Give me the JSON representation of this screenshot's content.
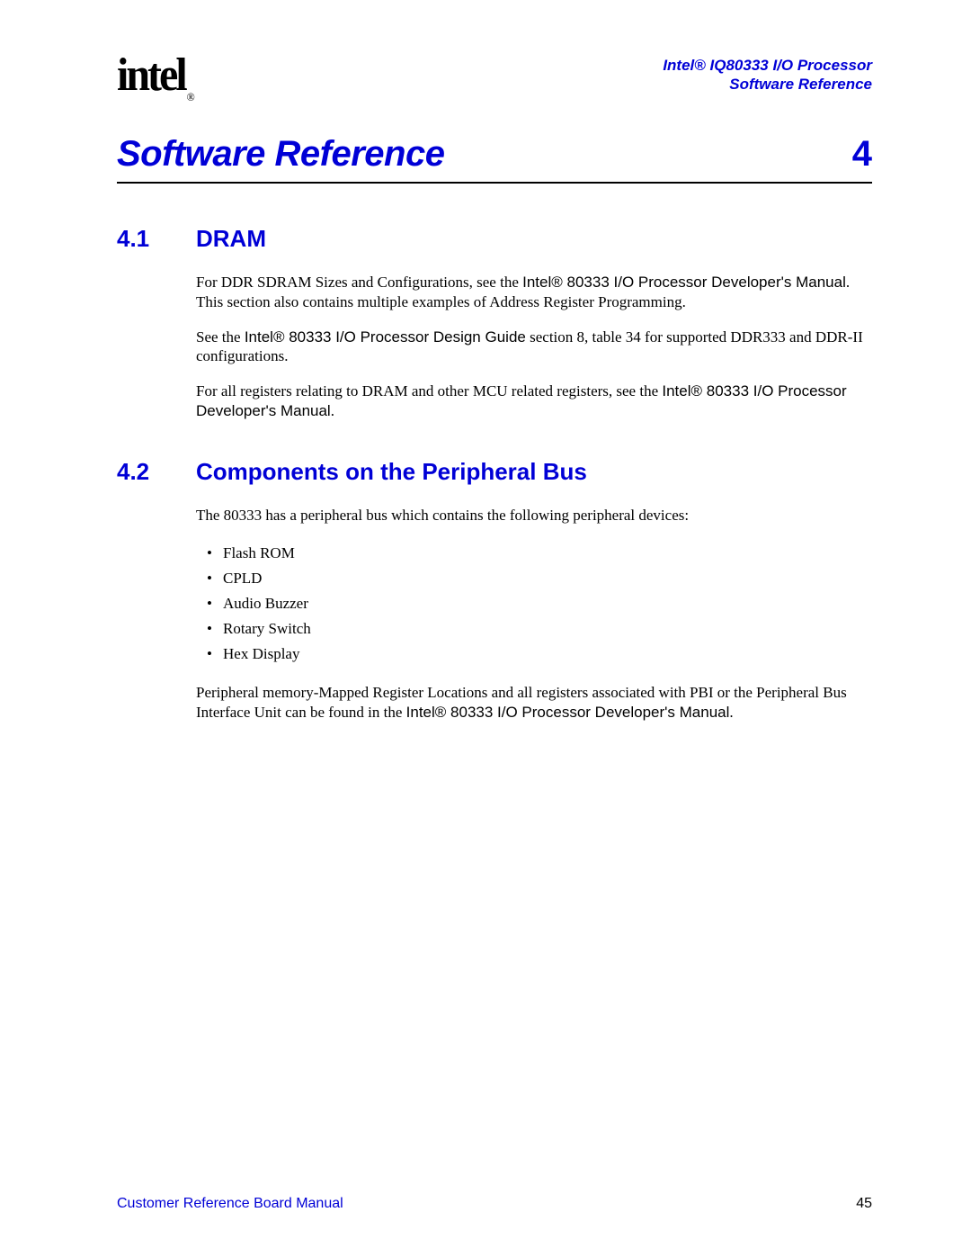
{
  "header": {
    "logo_text": "intel",
    "logo_reg": "®",
    "product": "Intel® IQ80333 I/O Processor",
    "subtitle": "Software Reference"
  },
  "chapter": {
    "title": "Software Reference",
    "number": "4"
  },
  "sections": {
    "s41": {
      "num": "4.1",
      "title": "DRAM",
      "p1a": "For DDR SDRAM Sizes and Configurations, see the ",
      "p1b": "Intel® 80333 I/O Processor Developer's Manual",
      "p1c": ". This section also contains multiple examples of Address Register Programming.",
      "p2a": "See the ",
      "p2b": "Intel® 80333 I/O Processor Design Guide",
      "p2c": " section 8, table 34 for supported DDR333 and DDR-II configurations.",
      "p3a": "For all registers relating to DRAM and other MCU related registers, see the ",
      "p3b": "Intel® 80333 I/O Processor Developer's Manual",
      "p3c": "."
    },
    "s42": {
      "num": "4.2",
      "title": "Components on the Peripheral Bus",
      "intro": "The 80333 has a peripheral bus which contains the following peripheral devices:",
      "items": [
        "Flash ROM",
        "CPLD",
        "Audio Buzzer",
        "Rotary Switch",
        "Hex Display"
      ],
      "outroA": "Peripheral memory-Mapped Register Locations and all registers associated with PBI or the Peripheral Bus Interface Unit can be found in the ",
      "outroB": "Intel® 80333 I/O Processor Developer's Manual",
      "outroC": "."
    }
  },
  "footer": {
    "left": "Customer Reference Board Manual",
    "right": "45"
  }
}
